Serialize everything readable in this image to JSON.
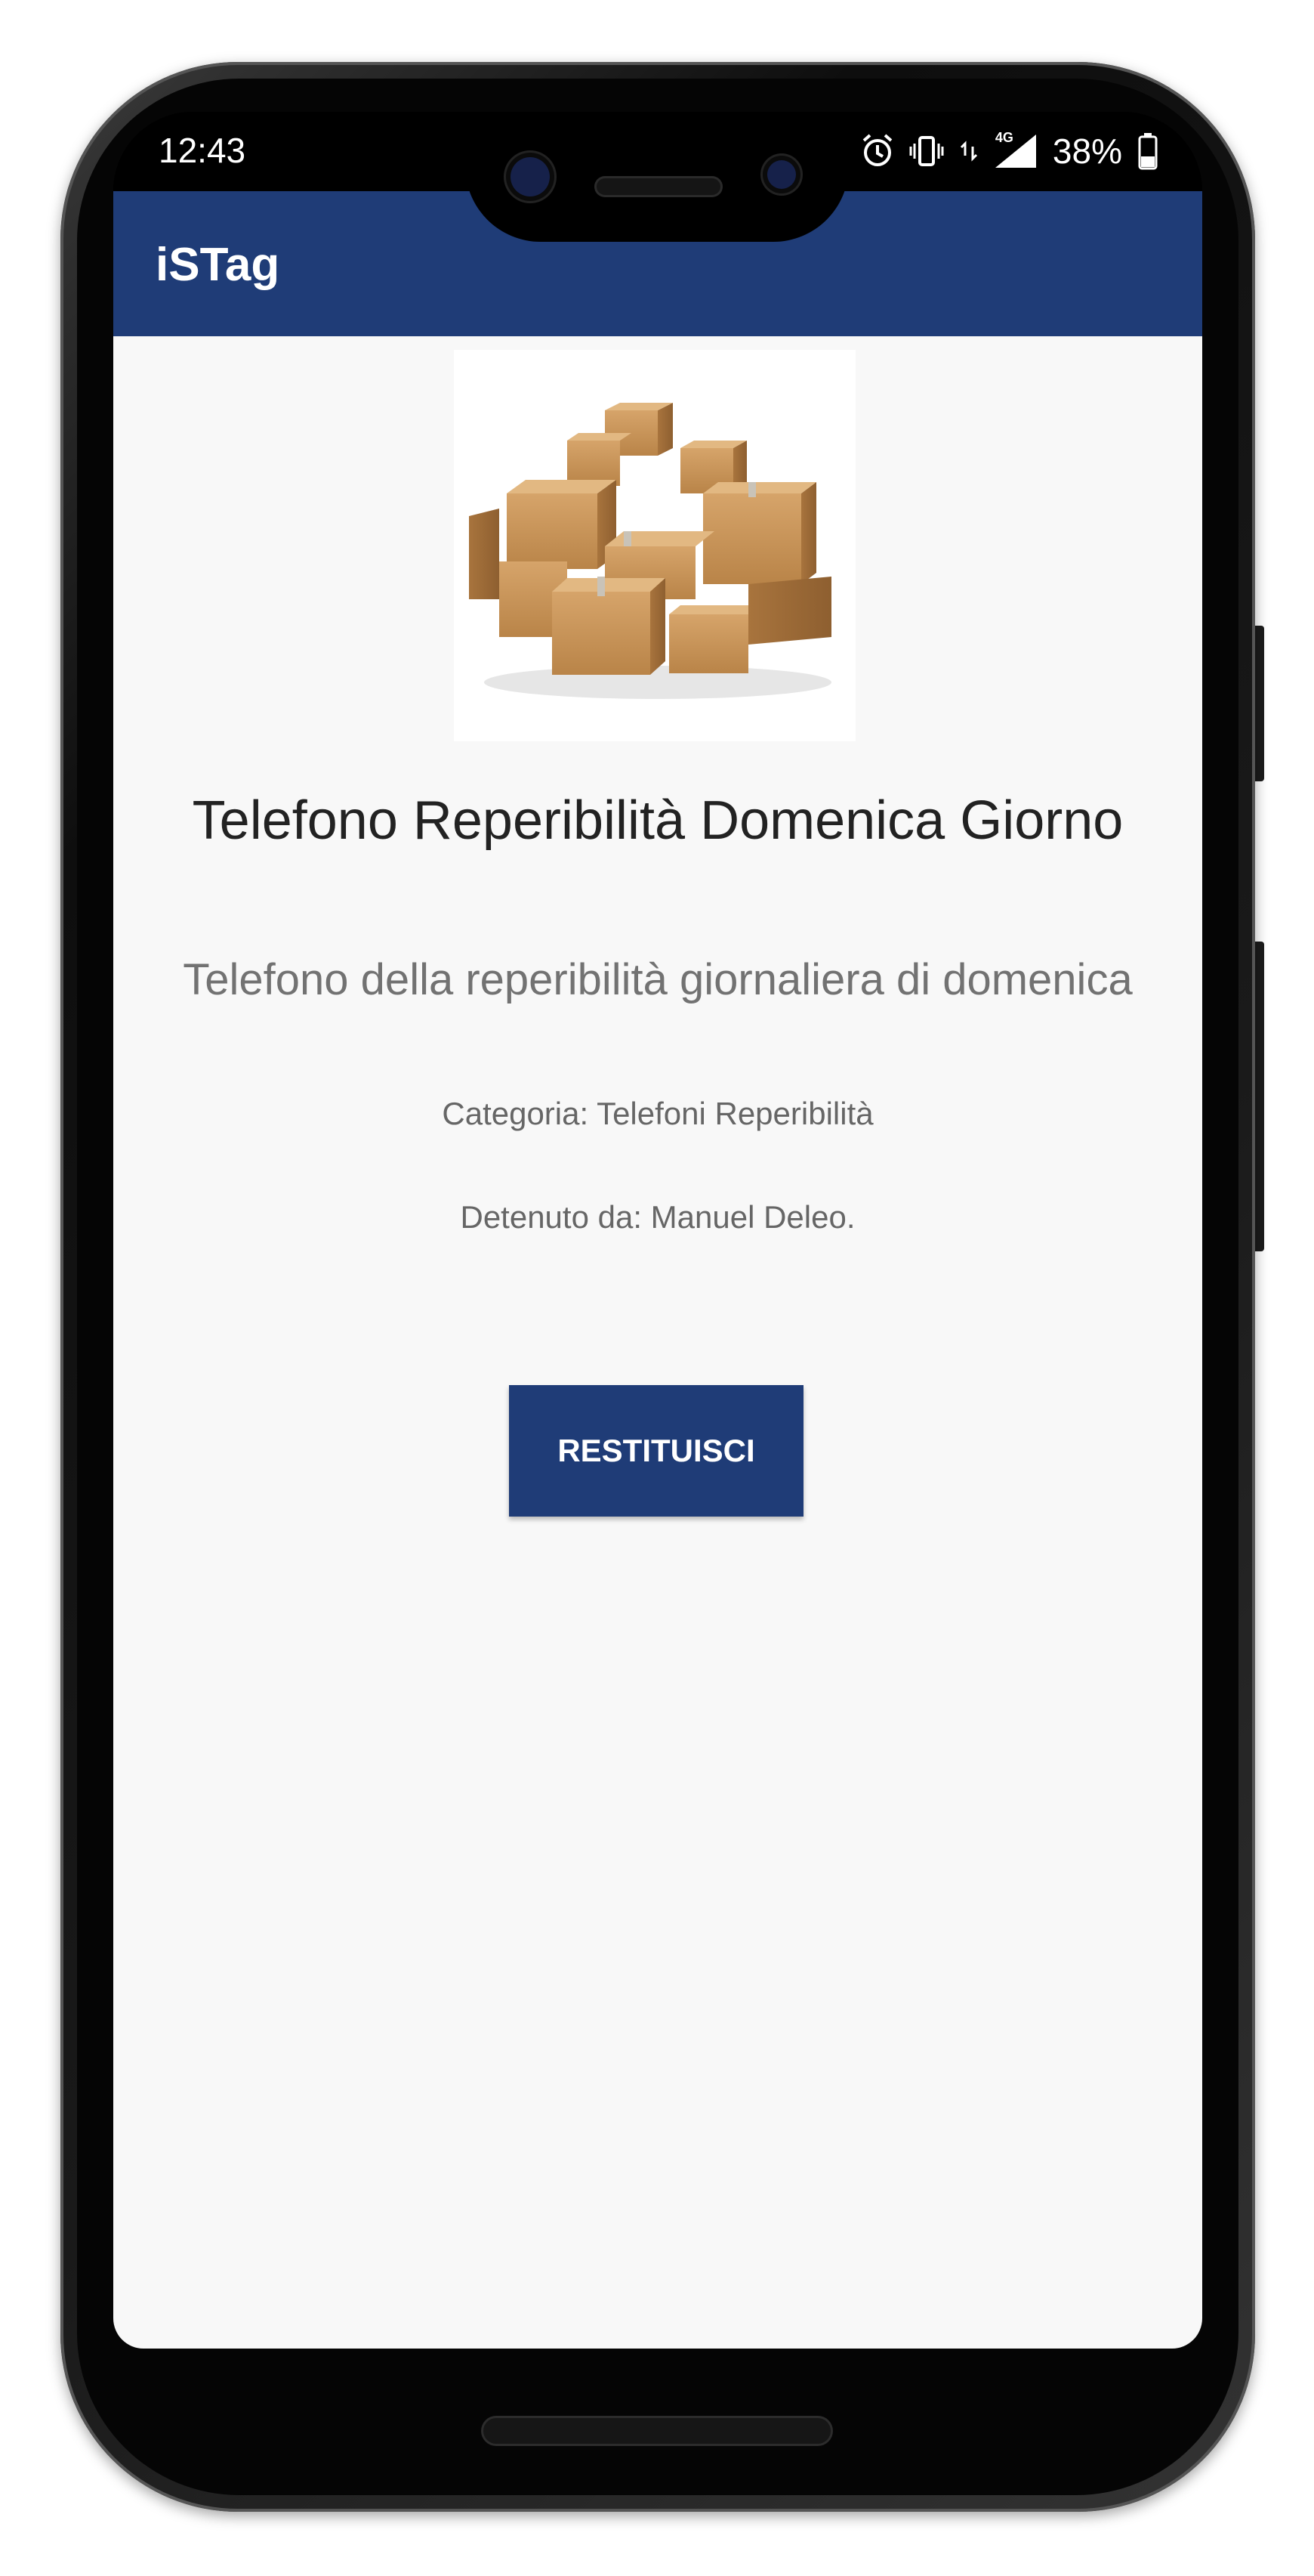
{
  "status_bar": {
    "time": "12:43",
    "network": "4G",
    "battery": "38%"
  },
  "app_bar": {
    "title": "iSTag"
  },
  "item": {
    "image_alt": "cardboard boxes",
    "title": "Telefono Reperibilità Domenica Giorno",
    "description": "Telefono della reperibilità giornaliera di domenica",
    "category": "Categoria: Telefoni Reperibilità",
    "holder": "Detenuto da: Manuel Deleo."
  },
  "actions": {
    "return_label": "RESTITUISCI"
  },
  "colors": {
    "primary": "#1f3c77",
    "background": "#f8f8f8",
    "title_text": "#222222",
    "secondary_text": "#727272"
  },
  "icons": [
    "alarm-icon",
    "vibrate-icon",
    "data-arrows-icon",
    "signal-icon",
    "battery-icon"
  ]
}
